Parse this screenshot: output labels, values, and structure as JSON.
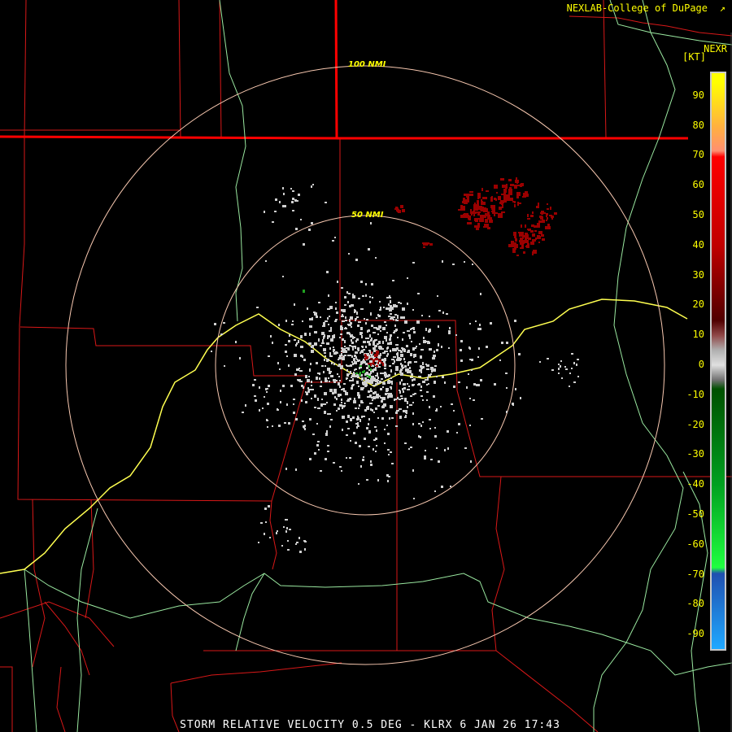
{
  "header": {
    "credit": "NEXLAB-College of DuPage",
    "product_code": "NEXR",
    "unit": "[KT]"
  },
  "caption": "STORM RELATIVE VELOCITY 0.5 DEG - KLRX 6 JAN 26 17:43",
  "range_rings": [
    {
      "label": "100 NMI",
      "nmi": 100
    },
    {
      "label": "50 NMI",
      "nmi": 50
    }
  ],
  "colors": {
    "county_border": "#e01818",
    "state_border": "#ff0000",
    "highway": "#9ae8a0",
    "interstate": "#ffff50",
    "ring": "#f8c8b0",
    "clutter": "#d0d0d0",
    "inbound_weak": "#20a020",
    "outbound_moderate": "#9a0000"
  },
  "legend": {
    "ticks": [
      "90",
      "80",
      "70",
      "60",
      "50",
      "40",
      "30",
      "20",
      "10",
      "0",
      "-10",
      "-20",
      "-30",
      "-40",
      "-50",
      "-60",
      "-70",
      "-80",
      "-90"
    ],
    "stops": [
      {
        "kt": 95,
        "color": "#ffff00"
      },
      {
        "kt": 80,
        "color": "#ffb040"
      },
      {
        "kt": 72,
        "color": "#ff9070"
      },
      {
        "kt": 70,
        "color": "#ff0000"
      },
      {
        "kt": 40,
        "color": "#c00000"
      },
      {
        "kt": 15,
        "color": "#500000"
      },
      {
        "kt": 10,
        "color": "#904848"
      },
      {
        "kt": 5,
        "color": "#b0b0b0"
      },
      {
        "kt": 0,
        "color": "#e0e0e0"
      },
      {
        "kt": -5,
        "color": "#707070"
      },
      {
        "kt": -8,
        "color": "#005000"
      },
      {
        "kt": -40,
        "color": "#00a020"
      },
      {
        "kt": -68,
        "color": "#20ff40"
      },
      {
        "kt": -70,
        "color": "#2050b0"
      },
      {
        "kt": -95,
        "color": "#20a8ff"
      }
    ]
  }
}
